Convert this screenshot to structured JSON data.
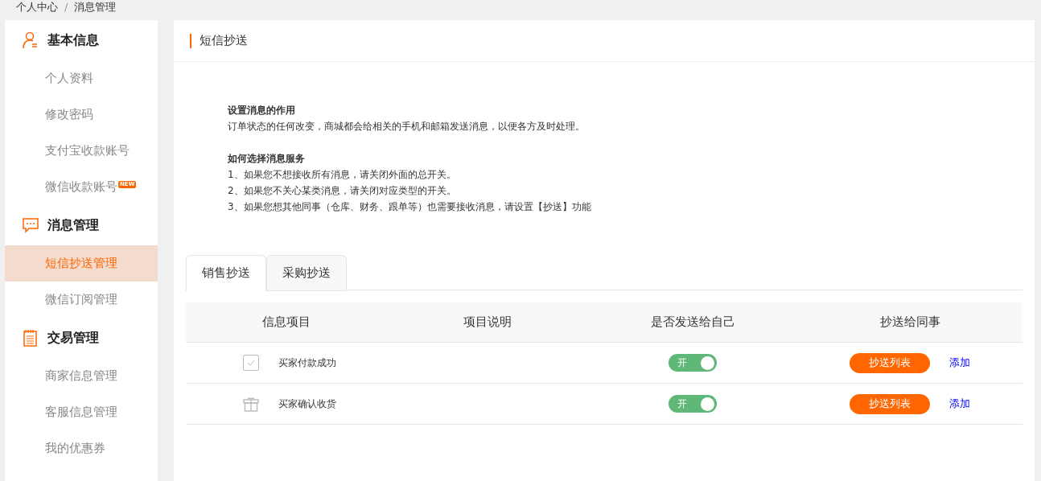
{
  "breadcrumb": {
    "items": [
      "个人中心",
      "消息管理"
    ],
    "separator": "/"
  },
  "sidebar": {
    "groups": [
      {
        "title": "基本信息",
        "kind": "person",
        "items": [
          {
            "label": "个人资料",
            "selected": false
          },
          {
            "label": "修改密码",
            "selected": false
          },
          {
            "label": "支付宝收款账号",
            "selected": false
          },
          {
            "label": "微信收款账号",
            "selected": false,
            "badge": "NEW"
          }
        ]
      },
      {
        "title": "消息管理",
        "kind": "chat",
        "items": [
          {
            "label": "短信抄送管理",
            "selected": true
          },
          {
            "label": "微信订阅管理",
            "selected": false
          }
        ]
      },
      {
        "title": "交易管理",
        "kind": "notepad",
        "items": [
          {
            "label": "商家信息管理",
            "selected": false
          },
          {
            "label": "客服信息管理",
            "selected": false
          },
          {
            "label": "我的优惠券",
            "selected": false
          }
        ]
      }
    ]
  },
  "panel_title": "短信抄送",
  "info": [
    {
      "heading": "设置消息的作用",
      "lines": [
        "订单状态的任何改变，商城都会给相关的手机和邮箱发送消息，以便各方及时处理。"
      ]
    },
    {
      "heading": "如何选择消息服务",
      "lines": [
        "1、如果您不想接收所有消息，请关闭外面的总开关。",
        "2、如果您不关心某类消息，请关闭对应类型的开关。",
        "3、如果您想其他同事（仓库、财务、跟单等）也需要接收消息，请设置【抄送】功能"
      ]
    }
  ],
  "tabs": [
    {
      "label": "销售抄送",
      "selected": true
    },
    {
      "label": "采购抄送",
      "selected": false
    }
  ],
  "table": {
    "columns": [
      "信息项目",
      "项目说明",
      "是否发送给自己",
      "抄送给同事"
    ],
    "rows": [
      {
        "kind": "check",
        "item": "买家付款成功",
        "toggle": {
          "on": true,
          "label": "开"
        },
        "list_button": "抄送列表",
        "add_link": "添加"
      },
      {
        "kind": "gift",
        "item": "买家确认收货",
        "toggle": {
          "on": true,
          "label": "开"
        },
        "list_button": "抄送列表",
        "add_link": "添加"
      }
    ]
  }
}
